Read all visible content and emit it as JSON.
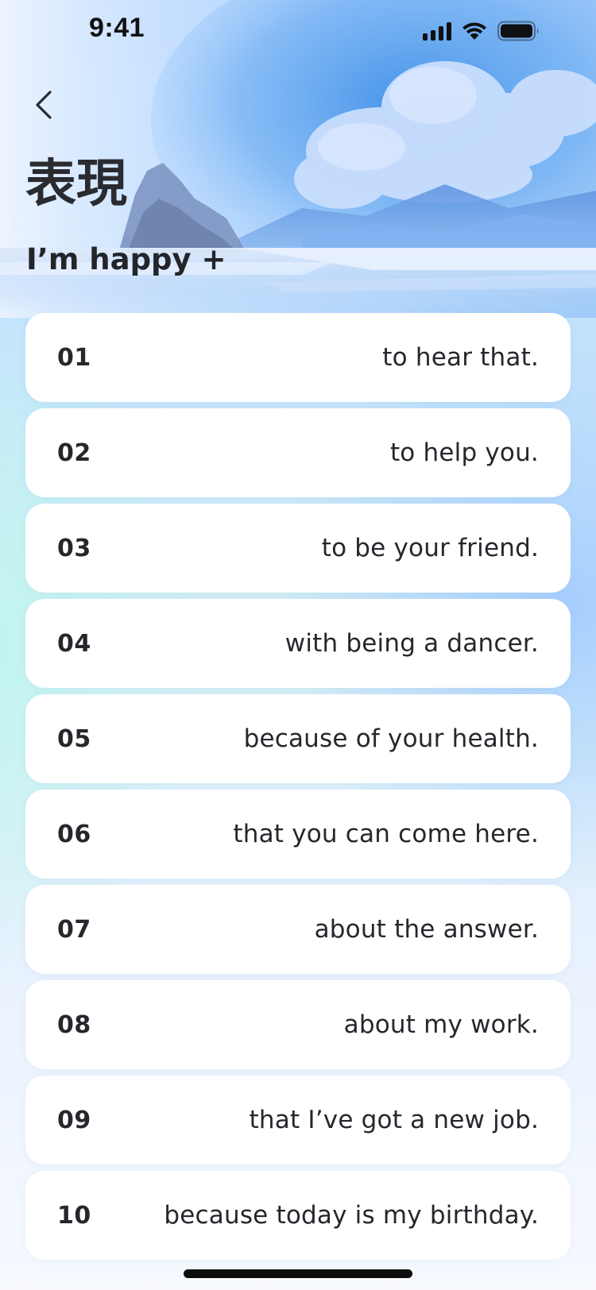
{
  "status_bar": {
    "time": "9:41"
  },
  "icons": {
    "back": "chevron-left-icon",
    "signal": "cellular-signal-icon",
    "wifi": "wifi-icon",
    "battery": "battery-icon"
  },
  "page": {
    "title": "表現",
    "section_heading": "I’m happy +"
  },
  "phrases": [
    {
      "number": "01",
      "text": "to hear that."
    },
    {
      "number": "02",
      "text": "to help you."
    },
    {
      "number": "03",
      "text": "to be your friend."
    },
    {
      "number": "04",
      "text": "with being a dancer."
    },
    {
      "number": "05",
      "text": "because of your health."
    },
    {
      "number": "06",
      "text": "that you can come here."
    },
    {
      "number": "07",
      "text": "about the answer."
    },
    {
      "number": "08",
      "text": "about my work."
    },
    {
      "number": "09",
      "text": "that I’ve got a new job."
    },
    {
      "number": "10",
      "text": "because today is my birthday."
    }
  ],
  "colors": {
    "card": "#ffffff",
    "text": "#26272d",
    "sky_blue": "#5ea0ee",
    "background_top": "#b8d8ff",
    "background_mint": "#d6f1f4"
  }
}
